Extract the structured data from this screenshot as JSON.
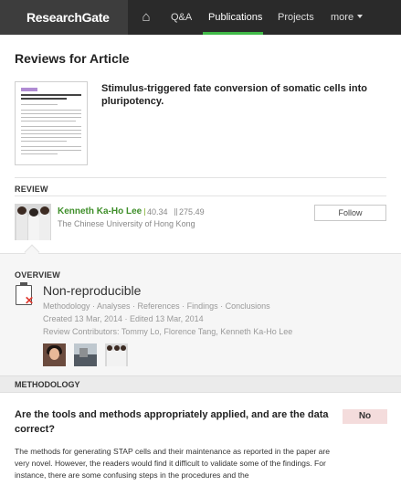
{
  "nav": {
    "logo": "ResearchGate",
    "home_glyph": "⌂",
    "items": [
      {
        "label": "Q&A"
      },
      {
        "label": "Publications"
      },
      {
        "label": "Projects"
      },
      {
        "label": "more"
      }
    ],
    "active": "Publications",
    "accent_color": "#40ba48"
  },
  "page": {
    "title": "Reviews for Article"
  },
  "article": {
    "title": "Stimulus-triggered fate conversion of somatic cells into pluripotency."
  },
  "review": {
    "section_label": "REVIEW",
    "reviewer_name": "Kenneth Ka-Ho Lee",
    "rg_score": "40.34",
    "impact_points": "275.49",
    "institution": "The Chinese University of Hong Kong",
    "follow_label": "Follow"
  },
  "overview": {
    "section_label": "OVERVIEW",
    "verdict": "Non-reproducible",
    "criteria": "Methodology · Analyses · References · Findings · Conclusions",
    "dates": "Created 13 Mar, 2014 · Edited 13 Mar, 2014",
    "contributors": "Review Contributors: Tommy Lo, Florence Tang, Kenneth Ka-Ho Lee",
    "verdict_icon": "clipboard-x-icon"
  },
  "methodology": {
    "section_label": "METHODOLOGY",
    "question": "Are the tools and methods appropriately applied, and are the data correct?",
    "answer": "No",
    "answer_color": "#f4dcdc",
    "body": "The methods for generating STAP cells and their maintenance as reported in the paper are very novel. However, the readers would find it difficult to validate some of the findings. For instance, there are some confusing steps in the procedures and the"
  }
}
